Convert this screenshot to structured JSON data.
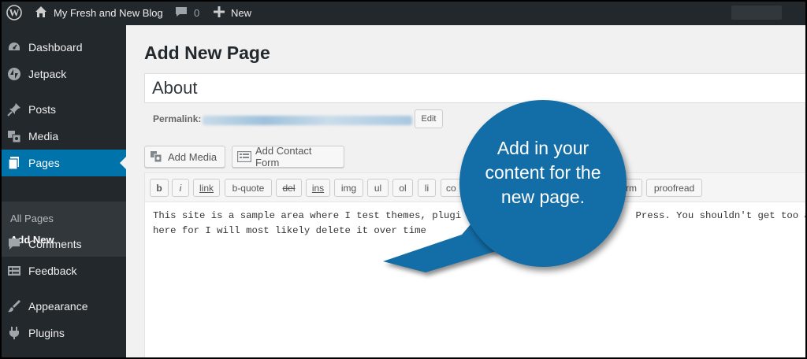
{
  "adminbar": {
    "site_name": "My Fresh and New Blog",
    "comments_count": "0",
    "new_label": "New",
    "icons": [
      "wordpress-logo-icon",
      "home-icon",
      "comment-bubble-icon",
      "plus-icon"
    ]
  },
  "sidebar": {
    "items": [
      {
        "label": "Dashboard",
        "icon": "dashboard-icon"
      },
      {
        "label": "Jetpack",
        "icon": "jetpack-icon"
      },
      {
        "label": "Posts",
        "icon": "pushpin-icon"
      },
      {
        "label": "Media",
        "icon": "media-icon"
      },
      {
        "label": "Pages",
        "icon": "pages-icon"
      },
      {
        "label": "Comments",
        "icon": "comment-icon"
      },
      {
        "label": "Feedback",
        "icon": "feedback-icon"
      },
      {
        "label": "Appearance",
        "icon": "paintbrush-icon"
      },
      {
        "label": "Plugins",
        "icon": "plugin-icon"
      }
    ],
    "submenu": [
      "All Pages",
      "Add New"
    ],
    "active_color": "#0073aa"
  },
  "main": {
    "heading": "Add New Page",
    "title_value": "About",
    "permalink_label": "Permalink:",
    "edit_label": "Edit",
    "add_media_label": "Add Media",
    "contact_form_label": "Add Contact Form",
    "toolbar": [
      "b",
      "i",
      "link",
      "b-quote",
      "del",
      "ins",
      "img",
      "ul",
      "ol",
      "li",
      "co",
      "rm",
      "proofread"
    ],
    "content_line1": "This site is a sample area where I test themes, plugi                              Press. You shouldn't get too atta",
    "content_line2": "here for I will most likely delete it over time"
  },
  "callout": {
    "text": "Add in your content for the new page.",
    "color": "#136ea8"
  }
}
